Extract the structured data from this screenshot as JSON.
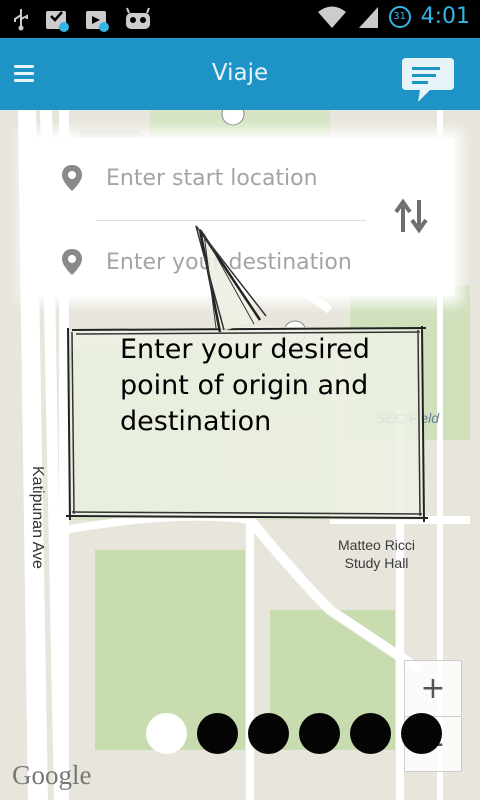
{
  "status_bar": {
    "time": "4:01",
    "calendar_day": "31",
    "icons": [
      "usb-icon",
      "download-icon",
      "download-icon",
      "android-icon",
      "wifi-icon",
      "signal-icon"
    ]
  },
  "action_bar": {
    "title": "Viaje",
    "menu_icon": "menu-icon",
    "chat_icon": "chat-icon"
  },
  "search": {
    "start_placeholder": "Enter start location",
    "destination_placeholder": "Enter your destination",
    "swap_icon": "swap-vertical-icon"
  },
  "tutorial": {
    "message": "Enter your desired point of origin and destination",
    "page_count": 6,
    "active_page": 1
  },
  "map": {
    "street_label": "Katipunan Ave",
    "poi_name": "Matteo Ricci\nStudy Hall",
    "field_name": "SEC Field",
    "zoom_in": "+",
    "zoom_out": "−",
    "attribution": "Google"
  },
  "colors": {
    "action_bar": "#1e94c6",
    "status_accent": "#33b5e5",
    "map_bg": "#e8e5dc",
    "green_area": "#c8dcb0"
  }
}
